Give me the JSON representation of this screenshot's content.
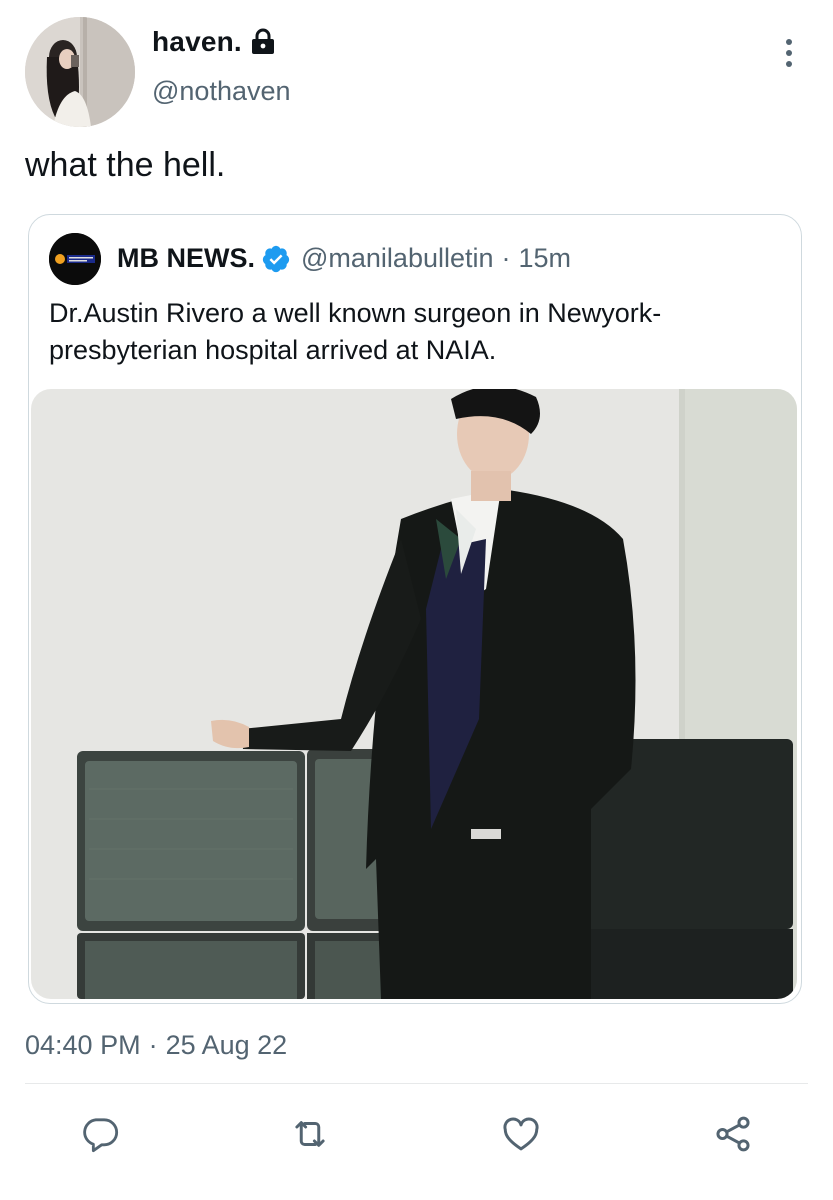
{
  "tweet": {
    "display_name": "haven.",
    "handle": "@nothaven",
    "text": "what the hell.",
    "timestamp_time": "04:40 PM",
    "timestamp_sep": "·",
    "timestamp_date": "25 Aug 22",
    "icons": {
      "lock": "lock-icon",
      "more": "more-options-icon"
    }
  },
  "quote": {
    "name": "MB NEWS.",
    "handle": "@manilabulletin",
    "sep": "·",
    "time": "15m",
    "text": "Dr.Austin Rivero a well known surgeon in Newyork-presbyterian hospital arrived at NAIA.",
    "verified_icon": "verified-badge-icon"
  },
  "actions": [
    {
      "name": "reply-button",
      "icon": "reply-icon"
    },
    {
      "name": "retweet-button",
      "icon": "retweet-icon"
    },
    {
      "name": "like-button",
      "icon": "heart-icon"
    },
    {
      "name": "share-button",
      "icon": "share-icon"
    }
  ],
  "colors": {
    "text_primary": "#0f1419",
    "text_secondary": "#536471",
    "verified_blue": "#1d9bf0",
    "border": "#cfd9de"
  }
}
